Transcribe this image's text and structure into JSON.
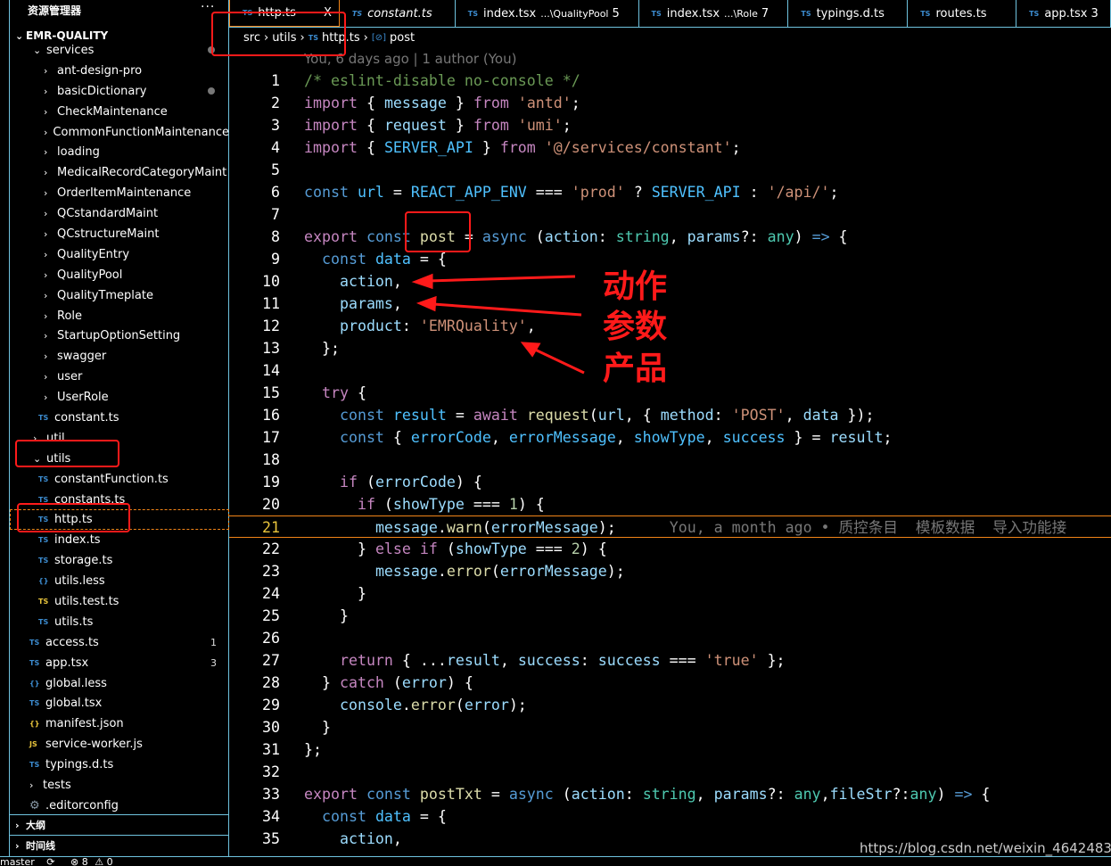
{
  "sidebar": {
    "title": "资源管理器",
    "more": "···",
    "root": "EMR-QUALITY",
    "items": [
      {
        "label": "services",
        "type": "folder",
        "level": 1,
        "open": true,
        "dot": true
      },
      {
        "label": "ant-design-pro",
        "type": "folder",
        "level": 2
      },
      {
        "label": "basicDictionary",
        "type": "folder",
        "level": 2,
        "dot": true
      },
      {
        "label": "CheckMaintenance",
        "type": "folder",
        "level": 2
      },
      {
        "label": "CommonFunctionMaintenance",
        "type": "folder",
        "level": 2
      },
      {
        "label": "loading",
        "type": "folder",
        "level": 2
      },
      {
        "label": "MedicalRecordCategoryMaint",
        "type": "folder",
        "level": 2
      },
      {
        "label": "OrderItemMaintenance",
        "type": "folder",
        "level": 2
      },
      {
        "label": "QCstandardMaint",
        "type": "folder",
        "level": 2
      },
      {
        "label": "QCstructureMaint",
        "type": "folder",
        "level": 2
      },
      {
        "label": "QualityEntry",
        "type": "folder",
        "level": 2
      },
      {
        "label": "QualityPool",
        "type": "folder",
        "level": 2
      },
      {
        "label": "QualityTmeplate",
        "type": "folder",
        "level": 2
      },
      {
        "label": "Role",
        "type": "folder",
        "level": 2
      },
      {
        "label": "StartupOptionSetting",
        "type": "folder",
        "level": 2
      },
      {
        "label": "swagger",
        "type": "folder",
        "level": 2
      },
      {
        "label": "user",
        "type": "folder",
        "level": 2
      },
      {
        "label": "UserRole",
        "type": "folder",
        "level": 2
      },
      {
        "label": "constant.ts",
        "type": "ts",
        "level": 2
      },
      {
        "label": "util",
        "type": "folder",
        "level": 1
      },
      {
        "label": "utils",
        "type": "folder",
        "level": 1,
        "open": true
      },
      {
        "label": "constantFunction.ts",
        "type": "ts",
        "level": 2
      },
      {
        "label": "constants.ts",
        "type": "ts",
        "level": 2
      },
      {
        "label": "http.ts",
        "type": "ts",
        "level": 2,
        "selected": true
      },
      {
        "label": "index.ts",
        "type": "ts",
        "level": 2
      },
      {
        "label": "storage.ts",
        "type": "ts",
        "level": 2
      },
      {
        "label": "utils.less",
        "type": "less",
        "level": 2
      },
      {
        "label": "utils.test.ts",
        "type": "test",
        "level": 2
      },
      {
        "label": "utils.ts",
        "type": "ts",
        "level": 2
      },
      {
        "label": "access.ts",
        "type": "ts",
        "level": 1,
        "badge": "1"
      },
      {
        "label": "app.tsx",
        "type": "ts",
        "level": 1,
        "badge": "3"
      },
      {
        "label": "global.less",
        "type": "less",
        "level": 1
      },
      {
        "label": "global.tsx",
        "type": "ts",
        "level": 1
      },
      {
        "label": "manifest.json",
        "type": "json",
        "level": 1
      },
      {
        "label": "service-worker.js",
        "type": "js",
        "level": 1
      },
      {
        "label": "typings.d.ts",
        "type": "ts",
        "level": 1
      },
      {
        "label": "tests",
        "type": "folder",
        "level": 0
      },
      {
        "label": ".editorconfig",
        "type": "gear",
        "level": 0
      }
    ],
    "sections": [
      "大纲",
      "时间线"
    ]
  },
  "status": {
    "branch": "master",
    "sync": "⟳",
    "errors": "⊗ 8",
    "warnings": "⚠ 0"
  },
  "tabs": [
    {
      "label": "http.ts",
      "active": true,
      "close": "X"
    },
    {
      "label": "constant.ts",
      "italic": true
    },
    {
      "label": "index.tsx",
      "path": "...\\QualityPool",
      "count": "5"
    },
    {
      "label": "index.tsx",
      "path": "...\\Role",
      "count": "7"
    },
    {
      "label": "typings.d.ts"
    },
    {
      "label": "routes.ts"
    },
    {
      "label": "app.tsx",
      "count": "3"
    }
  ],
  "breadcrumb": [
    "src",
    "utils",
    "http.ts",
    "post"
  ],
  "blame_header": "You, 6 days ago | 1 author (You)",
  "current_line": 21,
  "inline_blame": "You, a month ago • 质控条目  模板数据  导入功能接",
  "code": [
    [
      [
        "m",
        "/* eslint-disable no-console */"
      ]
    ],
    [
      [
        "c",
        "import"
      ],
      [
        "p",
        " { "
      ],
      [
        "v",
        "message"
      ],
      [
        "p",
        " } "
      ],
      [
        "c",
        "from"
      ],
      [
        "p",
        " "
      ],
      [
        "s",
        "'antd'"
      ],
      [
        "p",
        ";"
      ]
    ],
    [
      [
        "c",
        "import"
      ],
      [
        "p",
        " { "
      ],
      [
        "v",
        "request"
      ],
      [
        "p",
        " } "
      ],
      [
        "c",
        "from"
      ],
      [
        "p",
        " "
      ],
      [
        "s",
        "'umi'"
      ],
      [
        "p",
        ";"
      ]
    ],
    [
      [
        "c",
        "import"
      ],
      [
        "p",
        " { "
      ],
      [
        "q",
        "SERVER_API"
      ],
      [
        "p",
        " } "
      ],
      [
        "c",
        "from"
      ],
      [
        "p",
        " "
      ],
      [
        "s",
        "'@/services/constant'"
      ],
      [
        "p",
        ";"
      ]
    ],
    [],
    [
      [
        "k",
        "const"
      ],
      [
        "p",
        " "
      ],
      [
        "q",
        "url"
      ],
      [
        "p",
        " = "
      ],
      [
        "q",
        "REACT_APP_ENV"
      ],
      [
        "p",
        " === "
      ],
      [
        "s",
        "'prod'"
      ],
      [
        "p",
        " ? "
      ],
      [
        "q",
        "SERVER_API"
      ],
      [
        "p",
        " : "
      ],
      [
        "s",
        "'/api/'"
      ],
      [
        "p",
        ";"
      ]
    ],
    [],
    [
      [
        "c",
        "export"
      ],
      [
        "p",
        " "
      ],
      [
        "k",
        "const"
      ],
      [
        "p",
        " "
      ],
      [
        "f",
        "post"
      ],
      [
        "p",
        " = "
      ],
      [
        "k",
        "async"
      ],
      [
        "p",
        " ("
      ],
      [
        "v",
        "action"
      ],
      [
        "p",
        ": "
      ],
      [
        "t",
        "string"
      ],
      [
        "p",
        ", "
      ],
      [
        "v",
        "params"
      ],
      [
        "p",
        "?: "
      ],
      [
        "t",
        "any"
      ],
      [
        "p",
        ") "
      ],
      [
        "k",
        "=>"
      ],
      [
        "p",
        " {"
      ]
    ],
    [
      [
        "p",
        "  "
      ],
      [
        "k",
        "const"
      ],
      [
        "p",
        " "
      ],
      [
        "q",
        "data"
      ],
      [
        "p",
        " = {"
      ]
    ],
    [
      [
        "p",
        "    "
      ],
      [
        "v",
        "action"
      ],
      [
        "p",
        ","
      ]
    ],
    [
      [
        "p",
        "    "
      ],
      [
        "v",
        "params"
      ],
      [
        "p",
        ","
      ]
    ],
    [
      [
        "p",
        "    "
      ],
      [
        "v",
        "product"
      ],
      [
        "p",
        ": "
      ],
      [
        "s",
        "'EMRQuality'"
      ],
      [
        "p",
        ","
      ]
    ],
    [
      [
        "p",
        "  };"
      ]
    ],
    [],
    [
      [
        "p",
        "  "
      ],
      [
        "c",
        "try"
      ],
      [
        "p",
        " {"
      ]
    ],
    [
      [
        "p",
        "    "
      ],
      [
        "k",
        "const"
      ],
      [
        "p",
        " "
      ],
      [
        "q",
        "result"
      ],
      [
        "p",
        " = "
      ],
      [
        "c",
        "await"
      ],
      [
        "p",
        " "
      ],
      [
        "f",
        "request"
      ],
      [
        "p",
        "("
      ],
      [
        "v",
        "url"
      ],
      [
        "p",
        ", { "
      ],
      [
        "v",
        "method"
      ],
      [
        "p",
        ": "
      ],
      [
        "s",
        "'POST'"
      ],
      [
        "p",
        ", "
      ],
      [
        "v",
        "data"
      ],
      [
        "p",
        " });"
      ]
    ],
    [
      [
        "p",
        "    "
      ],
      [
        "k",
        "const"
      ],
      [
        "p",
        " { "
      ],
      [
        "q",
        "errorCode"
      ],
      [
        "p",
        ", "
      ],
      [
        "q",
        "errorMessage"
      ],
      [
        "p",
        ", "
      ],
      [
        "q",
        "showType"
      ],
      [
        "p",
        ", "
      ],
      [
        "q",
        "success"
      ],
      [
        "p",
        " } = "
      ],
      [
        "v",
        "result"
      ],
      [
        "p",
        ";"
      ]
    ],
    [],
    [
      [
        "p",
        "    "
      ],
      [
        "c",
        "if"
      ],
      [
        "p",
        " ("
      ],
      [
        "v",
        "errorCode"
      ],
      [
        "p",
        ") {"
      ]
    ],
    [
      [
        "p",
        "      "
      ],
      [
        "c",
        "if"
      ],
      [
        "p",
        " ("
      ],
      [
        "v",
        "showType"
      ],
      [
        "p",
        " === "
      ],
      [
        "n",
        "1"
      ],
      [
        "p",
        ") {"
      ]
    ],
    [
      [
        "p",
        "        "
      ],
      [
        "v",
        "message"
      ],
      [
        "p",
        "."
      ],
      [
        "f",
        "warn"
      ],
      [
        "p",
        "("
      ],
      [
        "v",
        "errorMessage"
      ],
      [
        "p",
        ");"
      ]
    ],
    [
      [
        "p",
        "      } "
      ],
      [
        "c",
        "else"
      ],
      [
        "p",
        " "
      ],
      [
        "c",
        "if"
      ],
      [
        "p",
        " ("
      ],
      [
        "v",
        "showType"
      ],
      [
        "p",
        " === "
      ],
      [
        "n",
        "2"
      ],
      [
        "p",
        ") {"
      ]
    ],
    [
      [
        "p",
        "        "
      ],
      [
        "v",
        "message"
      ],
      [
        "p",
        "."
      ],
      [
        "f",
        "error"
      ],
      [
        "p",
        "("
      ],
      [
        "v",
        "errorMessage"
      ],
      [
        "p",
        ");"
      ]
    ],
    [
      [
        "p",
        "      }"
      ]
    ],
    [
      [
        "p",
        "    }"
      ]
    ],
    [],
    [
      [
        "p",
        "    "
      ],
      [
        "c",
        "return"
      ],
      [
        "p",
        " { ..."
      ],
      [
        "v",
        "result"
      ],
      [
        "p",
        ", "
      ],
      [
        "v",
        "success"
      ],
      [
        "p",
        ": "
      ],
      [
        "v",
        "success"
      ],
      [
        "p",
        " === "
      ],
      [
        "s",
        "'true'"
      ],
      [
        "p",
        " };"
      ]
    ],
    [
      [
        "p",
        "  } "
      ],
      [
        "c",
        "catch"
      ],
      [
        "p",
        " ("
      ],
      [
        "v",
        "error"
      ],
      [
        "p",
        ") {"
      ]
    ],
    [
      [
        "p",
        "    "
      ],
      [
        "v",
        "console"
      ],
      [
        "p",
        "."
      ],
      [
        "f",
        "error"
      ],
      [
        "p",
        "("
      ],
      [
        "v",
        "error"
      ],
      [
        "p",
        ");"
      ]
    ],
    [
      [
        "p",
        "  }"
      ]
    ],
    [
      [
        "p",
        "};"
      ]
    ],
    [],
    [
      [
        "c",
        "export"
      ],
      [
        "p",
        " "
      ],
      [
        "k",
        "const"
      ],
      [
        "p",
        " "
      ],
      [
        "f",
        "postTxt"
      ],
      [
        "p",
        " = "
      ],
      [
        "k",
        "async"
      ],
      [
        "p",
        " ("
      ],
      [
        "v",
        "action"
      ],
      [
        "p",
        ": "
      ],
      [
        "t",
        "string"
      ],
      [
        "p",
        ", "
      ],
      [
        "v",
        "params"
      ],
      [
        "p",
        "?: "
      ],
      [
        "t",
        "any"
      ],
      [
        "p",
        ","
      ],
      [
        "v",
        "fileStr"
      ],
      [
        "p",
        "?:"
      ],
      [
        "t",
        "any"
      ],
      [
        "p",
        ") "
      ],
      [
        "k",
        "=>"
      ],
      [
        "p",
        " {"
      ]
    ],
    [
      [
        "p",
        "  "
      ],
      [
        "k",
        "const"
      ],
      [
        "p",
        " "
      ],
      [
        "q",
        "data"
      ],
      [
        "p",
        " = {"
      ]
    ],
    [
      [
        "p",
        "    "
      ],
      [
        "v",
        "action"
      ],
      [
        "p",
        ","
      ]
    ]
  ],
  "annotations": {
    "color": "#ff1a1a",
    "labels": [
      "动作",
      "参数",
      "产品"
    ]
  },
  "watermark": "https://blog.csdn.net/weixin_46424838"
}
